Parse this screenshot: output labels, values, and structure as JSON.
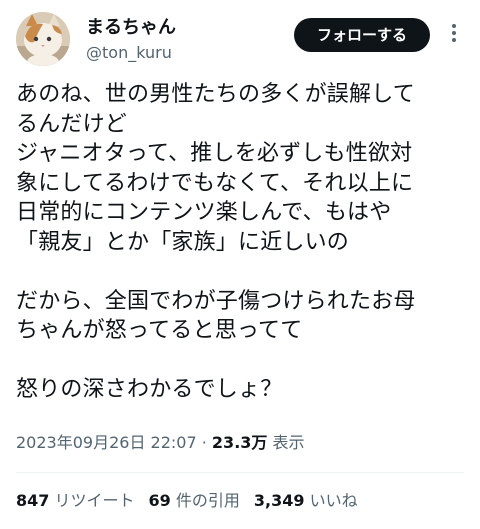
{
  "user": {
    "display_name": "まるちゃん",
    "handle": "@ton_kuru"
  },
  "follow_button_label": "フォローする",
  "more_icon": "more-vertical-icon",
  "tweet": {
    "lines": [
      "あのね、世の男性たちの多くが誤解して",
      "るんだけど",
      "ジャニオタって、推しを必ずしも性欲対",
      "象にしてるわけでもなくて、それ以上に",
      "日常的にコンテンツ楽しんで、もはや",
      "「親友」とか「家族」に近しいの",
      "",
      "だから、全国でわが子傷つけられたお母",
      "ちゃんが怒ってると思ってて",
      "",
      "怒りの深さわかるでしょ？"
    ]
  },
  "meta": {
    "timestamp": "2023年09月26日 22:07",
    "separator": "·",
    "views_count": "23.3万",
    "views_label": "表示"
  },
  "stats": {
    "retweets_count": "847",
    "retweets_label": "リツイート",
    "quotes_count": "69",
    "quotes_label": "件の引用",
    "likes_count": "3,349",
    "likes_label": "いいね"
  },
  "colors": {
    "text": "#0f1419",
    "secondary": "#536471",
    "button_bg": "#0f1419",
    "divider": "#eff3f4"
  }
}
